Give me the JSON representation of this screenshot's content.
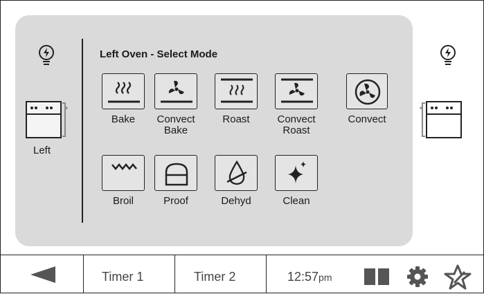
{
  "left_panel": {
    "label": "Left"
  },
  "header": {
    "title": "Left Oven - Select Mode"
  },
  "modes": [
    {
      "label_1": "Bake",
      "label_2": "",
      "icon": "bake-icon"
    },
    {
      "label_1": "Convect",
      "label_2": "Bake",
      "icon": "convect-bake-icon"
    },
    {
      "label_1": "Roast",
      "label_2": "",
      "icon": "roast-icon"
    },
    {
      "label_1": "Convect",
      "label_2": "Roast",
      "icon": "convect-roast-icon"
    },
    {
      "label_1": "Convect",
      "label_2": "",
      "icon": "convect-icon"
    },
    {
      "label_1": "Broil",
      "label_2": "",
      "icon": "broil-icon"
    },
    {
      "label_1": "Proof",
      "label_2": "",
      "icon": "proof-icon"
    },
    {
      "label_1": "Dehyd",
      "label_2": "",
      "icon": "dehydrate-icon"
    },
    {
      "label_1": "Clean",
      "label_2": "",
      "icon": "clean-icon"
    }
  ],
  "bottom_bar": {
    "timer1": "Timer 1",
    "timer2": "Timer 2",
    "time": "12:57",
    "time_suffix": "pm"
  },
  "colors": {
    "panel": "#dadada",
    "button": "#e4e4e4",
    "ink": "#222222",
    "accent_bar": "#555555"
  }
}
